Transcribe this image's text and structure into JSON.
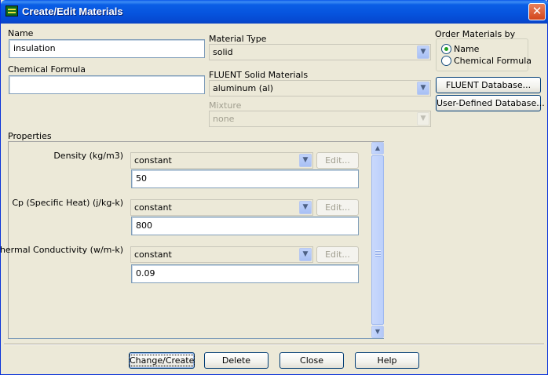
{
  "window": {
    "title": "Create/Edit Materials",
    "close_glyph": "✕"
  },
  "name": {
    "label": "Name",
    "value": "insulation"
  },
  "chemical_formula": {
    "label": "Chemical Formula",
    "value": ""
  },
  "material_type": {
    "label": "Material Type",
    "value": "solid"
  },
  "fluent_solid_materials": {
    "label": "FLUENT Solid Materials",
    "value": "aluminum (al)"
  },
  "mixture": {
    "label": "Mixture",
    "value": "none"
  },
  "order_by": {
    "label": "Order Materials by",
    "options": [
      "Name",
      "Chemical Formula"
    ],
    "selected": "Name"
  },
  "database_buttons": {
    "fluent": "FLUENT Database...",
    "user_defined": "User-Defined Database..."
  },
  "properties": {
    "label": "Properties",
    "items": [
      {
        "label": "Density (kg/m3)",
        "method": "constant",
        "edit": "Edit...",
        "value": "50"
      },
      {
        "label": "Cp (Specific Heat) (j/kg-k)",
        "method": "constant",
        "edit": "Edit...",
        "value": "800"
      },
      {
        "label": "Thermal Conductivity (w/m-k)",
        "method": "constant",
        "edit": "Edit...",
        "value": "0.09"
      }
    ]
  },
  "footer": {
    "change_create": "Change/Create",
    "delete": "Delete",
    "close": "Close",
    "help": "Help"
  },
  "colors": {
    "titlebar": "#0653dd",
    "dialog_bg": "#ece9d8",
    "radio_dot": "#21a121"
  }
}
